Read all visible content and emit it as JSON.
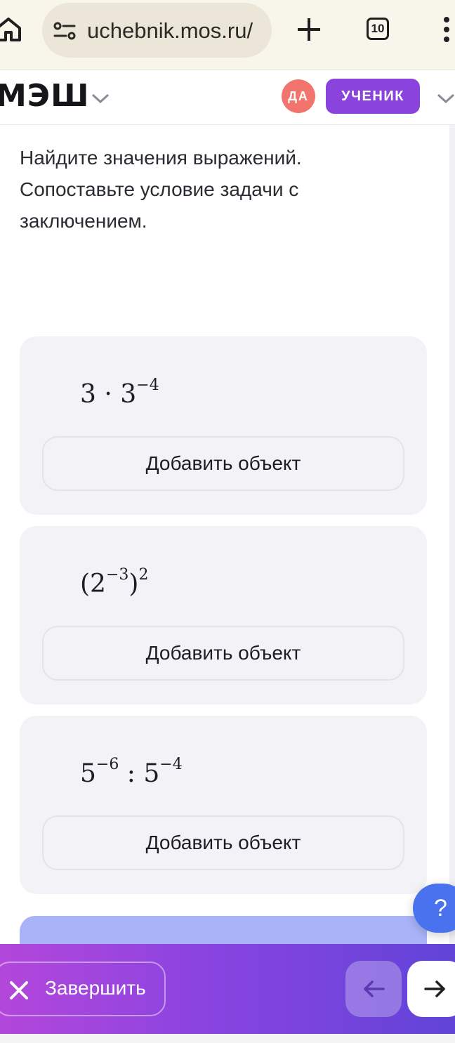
{
  "browser": {
    "url": "uchebnik.mos.ru/",
    "tab_count": "10"
  },
  "header": {
    "logo": "МЭШ",
    "avatar_initials": "ДА",
    "role": "УЧЕНИК"
  },
  "task": {
    "text": "Найдите значения выражений. Сопоставьте условие задачи с заключением."
  },
  "cards": [
    {
      "base1": "3 · 3",
      "exp1": "−4",
      "add_label": "Добавить объект"
    },
    {
      "open": "(2",
      "exp_inner": "−3",
      "close": ")",
      "exp_outer": "2",
      "add_label": "Добавить объект"
    },
    {
      "base1": "5",
      "exp1": "−6",
      "op": " : 5",
      "exp2": "−4",
      "add_label": "Добавить объект"
    }
  ],
  "help": {
    "label": "?"
  },
  "footer": {
    "finish_label": "Завершить"
  },
  "colors": {
    "brand_purple": "#8a44dd",
    "avatar_red": "#f2746e",
    "help_blue": "#4a72ee"
  }
}
